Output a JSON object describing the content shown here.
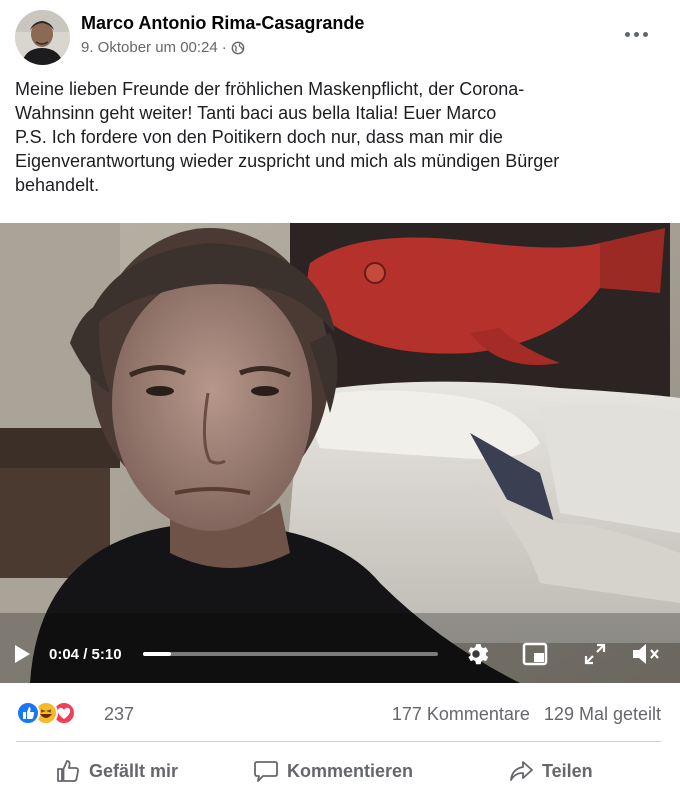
{
  "post": {
    "author": "Marco Antonio Rima-Casagrande",
    "date": "9. Oktober um 00:24",
    "separator": "·",
    "privacy_icon": "globe-icon",
    "more_icon": "more-options-icon",
    "text_lines": [
      "Meine lieben Freunde der fröhlichen Maskenpflicht, der Corona-",
      "Wahnsinn geht weiter! Tanti baci aus bella Italia! Euer Marco",
      "P.S. Ich fordere von den Poitikern doch nur, dass man mir die",
      "Eigenverantwortung wieder zuspricht und mich als mündigen Bürger",
      "behandelt."
    ]
  },
  "video": {
    "current_time": "0:04",
    "duration": "5:10",
    "time_display": "0:04 / 5:10",
    "progress": 0.0129,
    "controls": [
      "play-icon",
      "settings-icon",
      "picture-in-picture-icon",
      "fullscreen-icon",
      "mute-icon"
    ]
  },
  "stats": {
    "reactions": [
      "like",
      "haha",
      "love"
    ],
    "reaction_count": "237",
    "comments": "177 Kommentare",
    "shares": "129 Mal geteilt"
  },
  "actions": {
    "like_label": "Gefällt mir",
    "comment_label": "Kommentieren",
    "share_label": "Teilen"
  },
  "colors": {
    "like_blue": "#1877f2",
    "haha_yellow": "#f7b928",
    "love_red": "#f33e58",
    "secondary_text": "#65676b"
  }
}
